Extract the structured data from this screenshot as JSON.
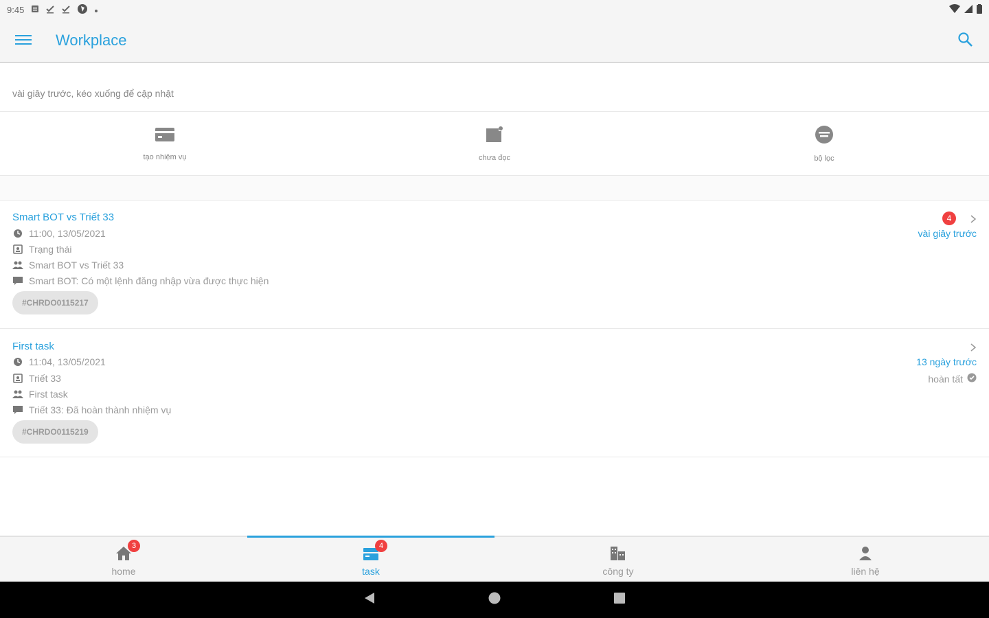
{
  "status_bar": {
    "time": "9:45",
    "left_icons": [
      "notification-square-icon",
      "task-check-icon",
      "task-check-icon",
      "app-circle-icon",
      "dot-icon"
    ],
    "right_icons": [
      "wifi-icon",
      "signal-icon",
      "battery-icon"
    ]
  },
  "app_bar": {
    "title": "Workplace"
  },
  "refresh_note": "vài giây trước, kéo xuống để cập nhật",
  "actions": [
    {
      "label": "tạo nhiệm vụ",
      "icon": "card-icon"
    },
    {
      "label": "chưa đọc",
      "icon": "unread-note-icon"
    },
    {
      "label": "bộ lọc",
      "icon": "filter-circle-icon"
    }
  ],
  "tasks": [
    {
      "title": "Smart BOT vs Triết 33",
      "datetime": "11:00, 13/05/2021",
      "assignee": "Trạng thái",
      "group": "Smart BOT vs Triết 33",
      "message": "Smart BOT: Có một lệnh đăng nhập vừa được thực hiện",
      "tag": "#CHRDO0115217",
      "time_ago": "vài giây trước",
      "badge": "4",
      "status": ""
    },
    {
      "title": "First task",
      "datetime": "11:04, 13/05/2021",
      "assignee": "Triết 33",
      "group": "First task",
      "message": "Triết 33: Đã hoàn thành nhiệm vụ",
      "tag": "#CHRDO0115219",
      "time_ago": "13 ngày trước",
      "badge": "",
      "status": "hoàn tất"
    }
  ],
  "bottom_nav": [
    {
      "label": "home",
      "icon": "home-icon",
      "badge": "3",
      "active": false
    },
    {
      "label": "task",
      "icon": "task-stack-icon",
      "badge": "4",
      "active": true
    },
    {
      "label": "công ty",
      "icon": "building-icon",
      "badge": "",
      "active": false
    },
    {
      "label": "liên hệ",
      "icon": "person-icon",
      "badge": "",
      "active": false
    }
  ],
  "colors": {
    "accent": "#2aa1dd",
    "badge": "#f04040",
    "text_muted": "#9a9a9a"
  }
}
